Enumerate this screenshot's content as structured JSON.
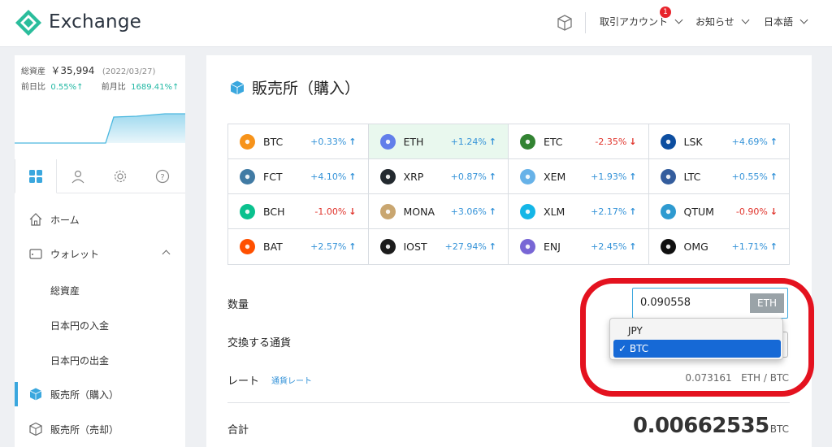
{
  "header": {
    "brand": "Exchange",
    "menus": [
      {
        "label": "取引アカウント",
        "badge": "1"
      },
      {
        "label": "お知らせ"
      },
      {
        "label": "日本語"
      }
    ]
  },
  "sidebar": {
    "assets_label": "総資産",
    "assets_value": "￥35,994",
    "assets_date": "(2022/03/27)",
    "day_label": "前日比",
    "day_value": "0.55%↑",
    "month_label": "前月比",
    "month_value": "1689.41%↑",
    "nav": [
      {
        "label": "ホーム",
        "icon": "home-icon"
      },
      {
        "label": "ウォレット",
        "icon": "wallet-icon"
      },
      {
        "label": "総資産"
      },
      {
        "label": "日本円の入金"
      },
      {
        "label": "日本円の出金"
      },
      {
        "label": "販売所（購入）",
        "icon": "cube-icon"
      },
      {
        "label": "販売所（売却）",
        "icon": "cube-outline-icon"
      }
    ]
  },
  "main": {
    "title": "販売所（購入）",
    "coins": [
      {
        "sym": "BTC",
        "chg": "+0.33%",
        "dir": "up",
        "color": "#f7931a"
      },
      {
        "sym": "ETH",
        "chg": "+1.24%",
        "dir": "up",
        "color": "#627eea"
      },
      {
        "sym": "ETC",
        "chg": "-2.35%",
        "dir": "down",
        "color": "#328332"
      },
      {
        "sym": "LSK",
        "chg": "+4.69%",
        "dir": "up",
        "color": "#0d4ea0"
      },
      {
        "sym": "FCT",
        "chg": "+4.10%",
        "dir": "up",
        "color": "#417ba4"
      },
      {
        "sym": "XRP",
        "chg": "+0.87%",
        "dir": "up",
        "color": "#23292f"
      },
      {
        "sym": "XEM",
        "chg": "+1.93%",
        "dir": "up",
        "color": "#67b2e8"
      },
      {
        "sym": "LTC",
        "chg": "+0.55%",
        "dir": "up",
        "color": "#345d9d"
      },
      {
        "sym": "BCH",
        "chg": "-1.00%",
        "dir": "down",
        "color": "#0ac18e"
      },
      {
        "sym": "MONA",
        "chg": "+3.06%",
        "dir": "up",
        "color": "#c9a670"
      },
      {
        "sym": "XLM",
        "chg": "+2.17%",
        "dir": "up",
        "color": "#14b6e7"
      },
      {
        "sym": "QTUM",
        "chg": "-0.90%",
        "dir": "down",
        "color": "#2e9ad0"
      },
      {
        "sym": "BAT",
        "chg": "+2.57%",
        "dir": "up",
        "color": "#ff5000"
      },
      {
        "sym": "IOST",
        "chg": "+27.94%",
        "dir": "up",
        "color": "#1c1c1c"
      },
      {
        "sym": "ENJ",
        "chg": "+2.45%",
        "dir": "up",
        "color": "#7866d5"
      },
      {
        "sym": "OMG",
        "chg": "+1.71%",
        "dir": "up",
        "color": "#101010"
      }
    ],
    "selected_coin": "ETH",
    "quantity_label": "数量",
    "quantity_value": "0.090558",
    "quantity_unit": "ETH",
    "currency_label": "交換する通貨",
    "currency_options": [
      "JPY",
      "BTC"
    ],
    "currency_selected": "BTC",
    "rate_label": "レート",
    "rate_link": "通貨レート",
    "rate_value": "0.073161",
    "rate_unit": "ETH / BTC",
    "total_label": "合計",
    "total_value": "0.00662535",
    "total_unit": "BTC"
  },
  "colors": {
    "accent": "#3aa7de",
    "up": "#3593d8",
    "down": "#e0332b",
    "highlight": "#e4121f",
    "selection": "#1669d6"
  }
}
